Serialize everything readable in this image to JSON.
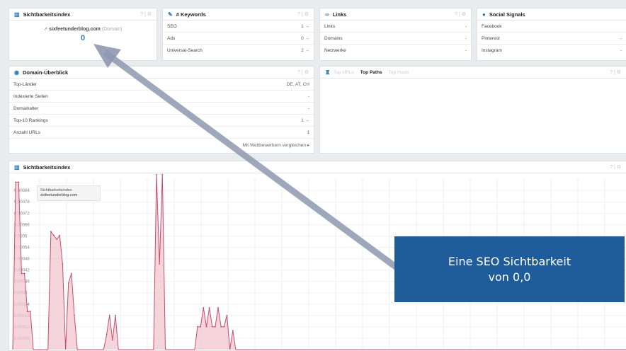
{
  "panels": {
    "visibility": {
      "title": "Sichtbarkeitsindex",
      "domain": "sixfeetunderblog.com",
      "domain_suffix": "(Domain)",
      "value": "0",
      "ctrl": "? | ⚙"
    },
    "keywords": {
      "title": "# Keywords",
      "ctrl": "? | ⚙",
      "rows": [
        {
          "label": "SEO",
          "value": "1 →"
        },
        {
          "label": "Ads",
          "value": "0 →"
        },
        {
          "label": "Universal-Search",
          "value": "2 →"
        }
      ]
    },
    "links": {
      "title": "Links",
      "ctrl": "? | ⚙",
      "rows": [
        {
          "label": "Links",
          "value": "-"
        },
        {
          "label": "Domains",
          "value": "-"
        },
        {
          "label": "Netzwerke",
          "value": "-"
        }
      ]
    },
    "social": {
      "title": "Social Signals",
      "rows": [
        {
          "label": "Facebook",
          "value": ""
        },
        {
          "label": "Pinterest",
          "value": "-"
        },
        {
          "label": "Instagram",
          "value": "-"
        }
      ]
    },
    "domain_overview": {
      "title": "Domain-Überblick",
      "ctrl": "? | ⚙",
      "rows": [
        {
          "label": "Top-Länder",
          "value": "DE, AT, CH"
        },
        {
          "label": "Indexierte Seiten",
          "value": "-"
        },
        {
          "label": "Domainalter",
          "value": "-"
        },
        {
          "label": "Top-10 Rankings",
          "value": "1 →"
        },
        {
          "label": "Anzahl URLs",
          "value": "1"
        }
      ],
      "compare_link": "Mit Wettbewerbern vergleichen ▸"
    },
    "paths": {
      "tabs": [
        "Top URLs",
        "Top Paths",
        "Top Hosts"
      ],
      "active_tab": "Top Paths",
      "ctrl": "? | ⚙"
    },
    "chart_panel": {
      "title": "Sichtbarkeitsindex",
      "ctrl": "? | ⚙",
      "legend_title": "Sichtbarkeitsindex",
      "legend_domain": "sixfeetunderblog.com"
    }
  },
  "overlay": {
    "line1": "Eine SEO Sichtbarkeit",
    "line2": "von 0,0"
  },
  "chart_data": {
    "type": "area",
    "ylabel": "",
    "y_tick_labels": [
      "0.00084",
      "0.00078",
      "0.00072",
      "0.00066",
      "0.0006",
      "0.00054",
      "0.00048",
      "0.00042",
      "0.00036",
      "0.0003",
      "0.00024",
      "0.00018",
      "0.00012",
      "0.00006"
    ],
    "ylim": [
      0,
      0.0009
    ],
    "values": [
      0,
      0.00088,
      0.00088,
      0.0004,
      0.0004,
      0.0002,
      0.0002,
      0,
      0,
      0,
      0,
      0,
      0,
      0.00062,
      0.0006,
      0.00058,
      0.0006,
      0.00045,
      0,
      0.00035,
      0.0004,
      0.00018,
      0,
      0,
      0,
      0,
      0,
      0,
      0,
      0,
      0,
      0,
      8e-05,
      0.00018,
      5e-05,
      0.00018,
      0,
      0,
      0,
      0,
      0,
      0,
      0,
      0,
      0,
      0,
      0,
      0,
      0,
      0.00092,
      0.00045,
      0.00092,
      0,
      0,
      0,
      0,
      0,
      0,
      0,
      0,
      0,
      0,
      0,
      0.00012,
      0.00012,
      0.00022,
      0.00012,
      0.00022,
      0.00012,
      0.00012,
      0.00022,
      0.00012,
      0.00012,
      0.00018,
      0,
      0.0001,
      0,
      0,
      0,
      0,
      0,
      0,
      0,
      0,
      0,
      0,
      0,
      0,
      0,
      0,
      0,
      0,
      0,
      0,
      0,
      0,
      0,
      0,
      0,
      0,
      0,
      0,
      0,
      0,
      0,
      0,
      0,
      0,
      0,
      0,
      0,
      0,
      0,
      0,
      0,
      0,
      0,
      0,
      0,
      0,
      0,
      0,
      0,
      0,
      0,
      0,
      0,
      0,
      0,
      0,
      0,
      0,
      0,
      0,
      0,
      0,
      0,
      0,
      0,
      0,
      0,
      0,
      0,
      0,
      0,
      0,
      0,
      0,
      0,
      0,
      0,
      0,
      0,
      0,
      0,
      0,
      0,
      0,
      0,
      0,
      0,
      0,
      0,
      0,
      0,
      0,
      0,
      0,
      0,
      0,
      0,
      0,
      0,
      0,
      0,
      0,
      0,
      0,
      0,
      0,
      0,
      0,
      0,
      0,
      0,
      0,
      0,
      0,
      0,
      0,
      0,
      0,
      0,
      0,
      0,
      0,
      0,
      0,
      0,
      0,
      0,
      0,
      0,
      0,
      0,
      0,
      0,
      0,
      0,
      0
    ],
    "series": [
      {
        "name": "sixfeetunderblog.com"
      }
    ],
    "grid": true,
    "colors": {
      "line": "#c2506a",
      "fill": "#f2c6cf"
    }
  }
}
